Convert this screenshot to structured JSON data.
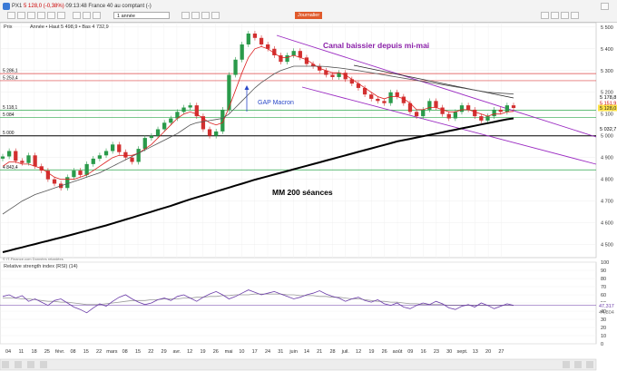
{
  "window": {
    "title": "PX1",
    "quote": "5 128,0 (-0,38%)",
    "quote_time": "09:13:48 France 40 au comptant (-)"
  },
  "toolbar": {
    "period_value": "1 année",
    "interval_value": "Journalier"
  },
  "legend": {
    "prices_label": "Prix",
    "stats": "Année • Haut 5 498,9 • Bas 4 732,9"
  },
  "rsi": {
    "title": "Relative strength index (RSI) (14)",
    "value_primary": "47,317",
    "value_secondary": "44,804",
    "ticks": [
      "100",
      "90",
      "80",
      "70",
      "60",
      "50",
      "40",
      "30",
      "20",
      "10",
      "0"
    ],
    "values": [
      58,
      60,
      56,
      59,
      52,
      55,
      51,
      47,
      53,
      55,
      50,
      45,
      42,
      38,
      44,
      49,
      46,
      52,
      57,
      60,
      55,
      51,
      48,
      50,
      54,
      56,
      53,
      58,
      60,
      56,
      52,
      57,
      61,
      64,
      60,
      55,
      58,
      62,
      66,
      63,
      60,
      62,
      64,
      61,
      58,
      55,
      57,
      60,
      62,
      65,
      61,
      58,
      56,
      52,
      55,
      57,
      53,
      51,
      54,
      49,
      47,
      50,
      45,
      43,
      47,
      50,
      48,
      52,
      49,
      44,
      42,
      46,
      48,
      45,
      50,
      47,
      43,
      46,
      49,
      47
    ],
    "average": [
      56,
      56,
      56,
      55,
      55,
      54,
      53,
      52,
      52,
      51,
      51,
      50,
      49,
      48,
      48,
      48,
      49,
      50,
      51,
      52,
      53,
      53,
      53,
      54,
      54,
      55,
      55,
      55,
      56,
      56,
      57,
      57,
      58,
      58,
      59,
      59,
      60,
      60,
      60,
      61,
      61,
      61,
      61,
      61,
      60,
      60,
      59,
      59,
      59,
      58,
      58,
      57,
      57,
      56,
      55,
      55,
      54,
      53,
      52,
      52,
      51,
      51,
      50,
      49,
      49,
      48,
      48,
      48,
      48,
      47,
      47,
      47,
      47,
      47,
      47,
      47,
      47,
      47,
      47,
      47
    ]
  },
  "chart_data": {
    "type": "line",
    "title": "",
    "xlabel": "",
    "ylabel": "",
    "ylim": [
      4440,
      5520
    ],
    "grid": true,
    "y_ticks": [
      "5 500",
      "5 400",
      "5 300",
      "5 200",
      "5 100",
      "5 000",
      "4 900",
      "4 800",
      "4 700",
      "4 600",
      "4 500"
    ],
    "x_ticks": [
      "04",
      "11",
      "18",
      "25",
      "févr.",
      "08",
      "15",
      "22",
      "mars",
      "08",
      "15",
      "22",
      "29",
      "avr.",
      "12",
      "19",
      "26",
      "mai",
      "10",
      "17",
      "24",
      "31",
      "juin",
      "14",
      "21",
      "28",
      "juil.",
      "12",
      "19",
      "26",
      "août",
      "09",
      "16",
      "23",
      "30",
      "sept.",
      "13",
      "20",
      "27"
    ],
    "series": [
      {
        "values": [
          4905,
          4930,
          4885,
          4875,
          4910,
          4860,
          4840,
          4800,
          4780,
          4760,
          4810,
          4840,
          4820,
          4870,
          4895,
          4910,
          4930,
          4960,
          4925,
          4900,
          4880,
          4940,
          4990,
          5000,
          5030,
          5060,
          5080,
          5110,
          5130,
          5140,
          5090,
          5030,
          5000,
          5020,
          5120,
          5280,
          5350,
          5420,
          5470,
          5450,
          5420,
          5400,
          5370,
          5340,
          5370,
          5390,
          5360,
          5330,
          5320,
          5300,
          5280,
          5270,
          5290,
          5260,
          5240,
          5220,
          5190,
          5170,
          5160,
          5150,
          5200,
          5180,
          5150,
          5110,
          5090,
          5120,
          5160,
          5130,
          5100,
          5080,
          5110,
          5140,
          5120,
          5090,
          5070,
          5090,
          5120,
          5110,
          5140,
          5128
        ]
      },
      {
        "values": [
          4860,
          4880,
          4880,
          4870,
          4870,
          4860,
          4850,
          4830,
          4810,
          4800,
          4800,
          4800,
          4810,
          4820,
          4840,
          4860,
          4880,
          4900,
          4910,
          4910,
          4910,
          4920,
          4940,
          4960,
          4990,
          5020,
          5050,
          5080,
          5100,
          5110,
          5100,
          5080,
          5060,
          5050,
          5060,
          5130,
          5210,
          5290,
          5360,
          5400,
          5410,
          5400,
          5380,
          5360,
          5360,
          5370,
          5360,
          5350,
          5330,
          5310,
          5300,
          5290,
          5290,
          5280,
          5260,
          5240,
          5220,
          5200,
          5180,
          5170,
          5180,
          5180,
          5170,
          5150,
          5120,
          5120,
          5130,
          5130,
          5120,
          5110,
          5110,
          5120,
          5120,
          5110,
          5100,
          5090,
          5100,
          5100,
          5110,
          5112
        ]
      },
      {
        "values": [
          4640,
          4660,
          4680,
          4700,
          4715,
          4730,
          4740,
          4750,
          4760,
          4770,
          4780,
          4790,
          4800,
          4810,
          4820,
          4830,
          4845,
          4860,
          4875,
          4890,
          4905,
          4920,
          4935,
          4950,
          4965,
          4980,
          4995,
          5010,
          5030,
          5050,
          5060,
          5065,
          5070,
          5075,
          5080,
          5100,
          5130,
          5160,
          5190,
          5220,
          5245,
          5265,
          5285,
          5300,
          5310,
          5320,
          5320,
          5320,
          5320,
          5320,
          5318,
          5315,
          5312,
          5308,
          5304,
          5300,
          5295,
          5290,
          5285,
          5280,
          5275,
          5270,
          5265,
          5260,
          5255,
          5250,
          5245,
          5240,
          5235,
          5230,
          5225,
          5220,
          5215,
          5210,
          5205,
          5200,
          5198,
          5196,
          5194,
          5192
        ]
      },
      {
        "values": [
          4465,
          4472,
          4480,
          4487,
          4495,
          4502,
          4510,
          4517,
          4525,
          4532,
          4540,
          4548,
          4556,
          4564,
          4572,
          4580,
          4588,
          4597,
          4606,
          4615,
          4624,
          4633,
          4642,
          4651,
          4660,
          4669,
          4678,
          4688,
          4698,
          4708,
          4717,
          4726,
          4735,
          4744,
          4753,
          4762,
          4771,
          4780,
          4789,
          4798,
          4806,
          4814,
          4822,
          4830,
          4838,
          4846,
          4854,
          4862,
          4870,
          4878,
          4886,
          4894,
          4902,
          4910,
          4918,
          4926,
          4934,
          4942,
          4950,
          4958,
          4966,
          4974,
          4980,
          4986,
          4992,
          4998,
          5004,
          5010,
          5016,
          5022,
          5028,
          5034,
          5040,
          5046,
          5052,
          5058,
          5064,
          5070,
          5076,
          5080
        ]
      }
    ],
    "levels": [
      {
        "value": 5286.1,
        "label": "5 286,1"
      },
      {
        "value": 5253.4,
        "label": "5 253,4"
      },
      {
        "value": 5118.1,
        "label": "5 118,1"
      },
      {
        "value": 5084,
        "label": "5 084"
      },
      {
        "value": 5000,
        "label": "5 000"
      },
      {
        "value": 4843.4,
        "label": "4 843,4"
      }
    ],
    "right_labels": [
      {
        "value": 5178.8,
        "label": "5 178,8",
        "color": "#000000"
      },
      {
        "value": 5151.9,
        "label": "5 151,9",
        "color": "#cc0000"
      },
      {
        "value": 5128.0,
        "label": "5 128,0",
        "color": "#222222",
        "bg": "#ffe24a"
      },
      {
        "value": 5032.7,
        "label": "5 032,7",
        "color": "#000000"
      }
    ],
    "annotations": [
      {
        "text": "Canal baissier depuis mi-mai",
        "color": "#8a1fa8"
      },
      {
        "text": "GAP Macron",
        "color": "#2a48c8"
      },
      {
        "text": "MM 200 séances",
        "color": "#000000"
      }
    ],
    "colors": {
      "price_up": "#2a9a4a",
      "price_down": "#d23030",
      "ma_short": "#dc1e1e",
      "ma_long": "#555555",
      "ma200": "#000000",
      "channel": "#9b2bc2",
      "level_red": "#dd4444",
      "level_green": "#2ea84c",
      "rsi_line": "#6a3aa8"
    }
  },
  "footer": {
    "source": "© IT-Finance.com   Données retardées"
  }
}
